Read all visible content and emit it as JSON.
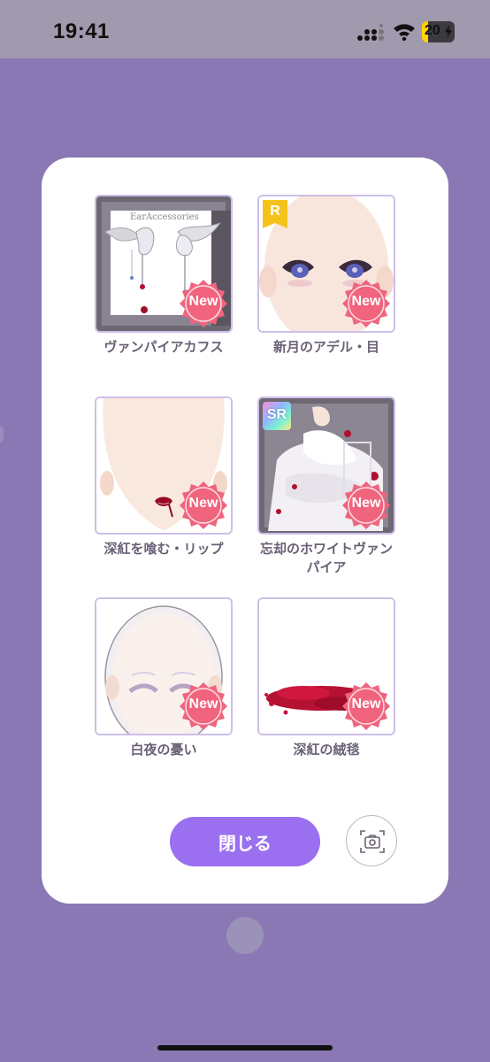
{
  "status_bar": {
    "time": "19:41",
    "battery_percent": "20",
    "battery_level": 0.2,
    "battery_color": "#ffd400"
  },
  "dialog": {
    "items": [
      {
        "label": "ヴァンパイアカフス",
        "badge": "New",
        "image_text": "EarAccessories"
      },
      {
        "label": "新月のアデル・目",
        "badge": "New",
        "rarity": "R"
      },
      {
        "label": "深紅を喰む・リップ",
        "badge": "New"
      },
      {
        "label": "忘却のホワイトヴァンパイア",
        "badge": "New",
        "rarity": "SR"
      },
      {
        "label": "白夜の憂い",
        "badge": "New"
      },
      {
        "label": "深紅の絨毯",
        "badge": "New"
      }
    ],
    "close_label": "閉じる",
    "camera_icon": "camera-icon"
  },
  "colors": {
    "background": "#8a78b4",
    "accent_button": "#9a6ff0",
    "new_badge": "#f0647e",
    "thumb_border": "#cdbfe8",
    "label_text": "#6a6076"
  }
}
